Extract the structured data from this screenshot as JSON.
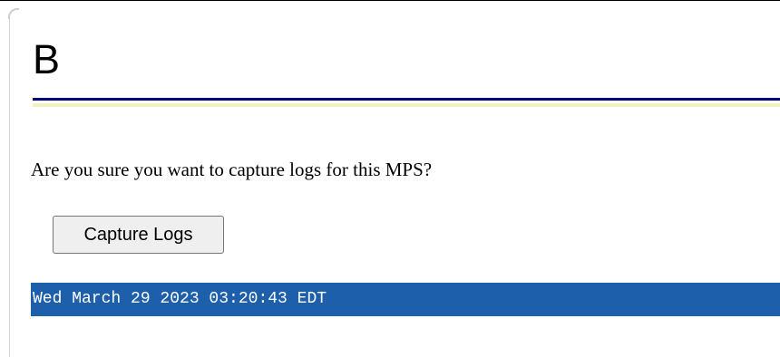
{
  "page": {
    "title": "B",
    "question": "Are you sure you want to capture logs for this MPS?",
    "capture_button_label": "Capture Logs",
    "timestamp": "Wed March 29 2023 03:20:43 EDT"
  },
  "colors": {
    "rule_primary": "#000080",
    "rule_secondary": "#f5f0c0",
    "status_bar_bg": "#1e5fac",
    "status_bar_text": "#ffffff"
  }
}
